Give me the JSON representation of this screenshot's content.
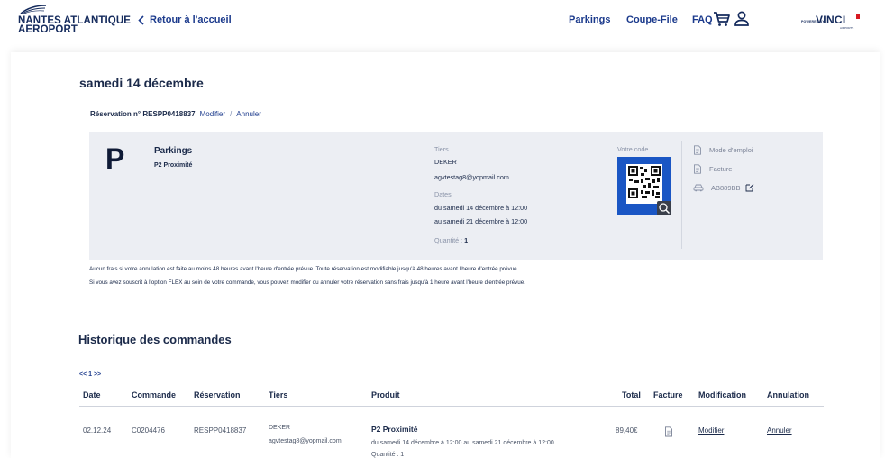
{
  "header": {
    "logo_line1": "NANTES ATLANTIQUE",
    "logo_line2": "AEROPORT",
    "back_label": "Retour à l'accueil",
    "nav": [
      "Parkings",
      "Coupe-File",
      "FAQ"
    ],
    "powered_by": "POWERED BY",
    "vinci": "VINCI",
    "vinci_sub": "AIRPORTS"
  },
  "booking": {
    "date_title": "samedi 14 décembre",
    "reservation_label": "Réservation n° RESPP0418837",
    "modify_label": "Modifier",
    "separator": "/",
    "cancel_label": "Annuler",
    "product_letter": "P",
    "product_title": "Parkings",
    "product_sub": "P2 Proximité",
    "tiers_label": "Tiers",
    "tiers_name": "DEKER",
    "tiers_email": "agvtestag8@yopmail.com",
    "dates_label": "Dates",
    "date_from": "du samedi 14 décembre à 12:00",
    "date_to": "au samedi 21 décembre à 12:00",
    "quantity_label": "Quantité :",
    "quantity_value": "1",
    "code_label": "Votre code",
    "manual_label": "Mode d'emploi",
    "invoice_label": "Facture",
    "plate": "AB889BB"
  },
  "notices": [
    "Aucun frais si votre annulation est faite au moins 48 heures avant l'heure d'entrée prévue. Toute réservation est modifiable jusqu'à 48 heures avant l'heure d'entrée prévue.",
    "Si vous avez souscrit à l'option FLEX au sein de votre commande, vous pouvez modifier ou annuler votre réservation sans frais jusqu'à 1 heure avant l'heure d'entrée prévue."
  ],
  "history": {
    "title": "Historique des commandes",
    "pager": "<< 1 >>",
    "columns": [
      "Date",
      "Commande",
      "Réservation",
      "Tiers",
      "Produit",
      "Total",
      "Facture",
      "Modification",
      "Annulation"
    ],
    "row": {
      "date": "02.12.24",
      "order": "C0204476",
      "reservation": "RESPP0418837",
      "tiers_name": "DEKER",
      "tiers_email": "agvtestag8@yopmail.com",
      "product": "P2 Proximité",
      "product_dates": "du samedi 14 décembre à 12:00 au samedi 21 décembre à 12:00",
      "product_qty": "Quantité : 1",
      "total": "89,40€",
      "modify": "Modifier",
      "cancel": "Annuler"
    }
  },
  "colors": {
    "brand_navy": "#142a5c",
    "link_blue": "#1b3a8c",
    "qr_blue": "#1a56c4",
    "card_bg": "#eceef3",
    "vinci_red": "#d71921"
  },
  "icons": [
    "chevron-left-icon",
    "cart-icon",
    "user-icon",
    "document-icon",
    "invoice-icon",
    "car-icon",
    "edit-icon",
    "zoom-icon"
  ]
}
